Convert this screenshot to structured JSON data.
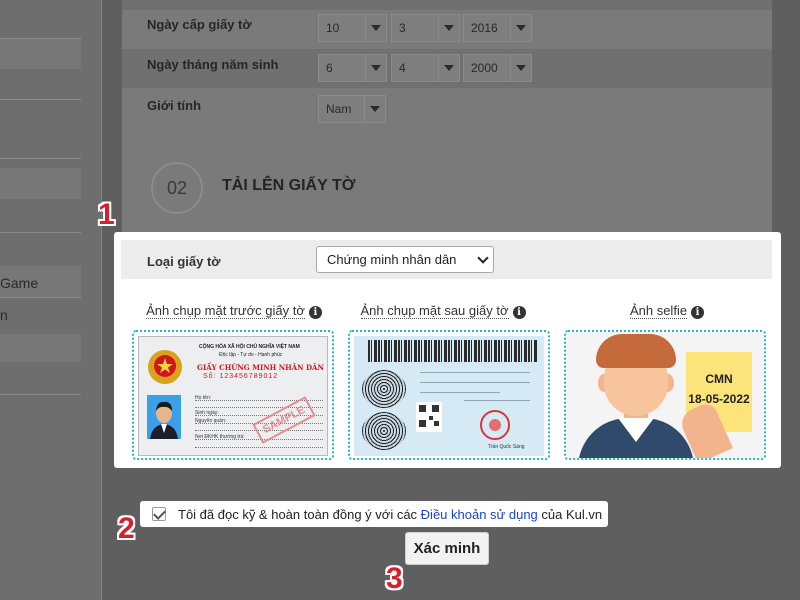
{
  "sidebar": {
    "items": [
      "Game",
      "n"
    ]
  },
  "form": {
    "issue_date": {
      "label": "Ngày cấp giấy tờ",
      "day": "10",
      "month": "3",
      "year": "2016"
    },
    "birth_date": {
      "label": "Ngày tháng năm sinh",
      "day": "6",
      "month": "4",
      "year": "2000"
    },
    "gender": {
      "label": "Giới tính",
      "value": "Nam"
    }
  },
  "section": {
    "number": "02",
    "title": "TẢI LÊN GIẤY TỜ"
  },
  "upload": {
    "doc_type_label": "Loại giấy tờ",
    "doc_type_value": "Chứng minh nhân dân",
    "front_label": "Ảnh chụp mặt trước giấy tờ",
    "back_label": "Ảnh chụp mặt sau giấy tờ",
    "selfie_label": "Ảnh selfie",
    "info_glyph": "i"
  },
  "front_card": {
    "line1": "CỘNG HÒA XÃ HỘI CHỦ NGHĨA VIỆT NAM",
    "line2": "Độc lập - Tự do - Hạnh phúc",
    "title": "GIẤY CHỨNG MINH NHÂN DÂN",
    "number": "Số: 123456789012",
    "fields": [
      "Họ tên:",
      "Sinh ngày:",
      "Nguyên quán:",
      "Nơi ĐKHK thường trú:"
    ],
    "stamp": "SAMPLE"
  },
  "back_card": {
    "signer": "Trần Quốc Sáng"
  },
  "selfie": {
    "note_line1": "CMN",
    "note_line2": "18-05-2022"
  },
  "agreement": {
    "prefix": "Tôi đã đọc kỹ & hoàn toàn đồng ý với các ",
    "link": "Điều khoản sử dụng",
    "suffix": " của Kul.vn",
    "checked": true
  },
  "verify_button": "Xác minh",
  "steps": [
    "1",
    "2",
    "3"
  ],
  "colors": {
    "dropzone_border": "#26b6bb",
    "step_red": "#d8202b",
    "link_blue": "#1a47c7"
  }
}
